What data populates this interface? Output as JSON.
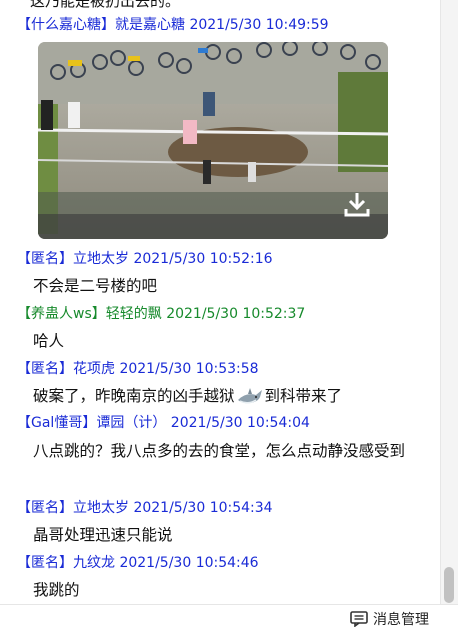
{
  "messages": [
    {
      "group": "什么嘉心糖",
      "sender": "就是嘉心糖",
      "time": "2021/5/30 10:49:59",
      "color": "blue"
    },
    {
      "group": "匿名",
      "sender": "立地太岁",
      "time": "2021/5/30 10:52:16",
      "color": "blue",
      "text": "不会是二号楼的吧"
    },
    {
      "group": "养蛊人ws",
      "sender": "轻轻的飘",
      "time": "2021/5/30 10:52:37",
      "color": "green",
      "text": "哈人"
    },
    {
      "group": "匿名",
      "sender": "花项虎",
      "time": "2021/5/30 10:53:58",
      "color": "blue",
      "text_before": "破案了，昨晚南京的凶手越狱",
      "text_after": "到科带来了"
    },
    {
      "group": "Gal懂哥",
      "sender": "谭园（计）",
      "time": "2021/5/30 10:54:04",
      "color": "blue",
      "text": "八点跳的？我八点多的去的食堂，怎么点动静没感受到"
    },
    {
      "group": "匿名",
      "sender": "立地太岁",
      "time": "2021/5/30 10:54:34",
      "color": "blue",
      "text": "晶哥处理迅速只能说"
    },
    {
      "group": "匿名",
      "sender": "九纹龙",
      "time": "2021/5/30 10:54:46",
      "color": "blue",
      "text": "我跳的"
    }
  ],
  "cut_text": "这乃能是被扔出去的。",
  "toolbar": {
    "manage_label": "消息管理"
  },
  "icons": {
    "download": "download-icon",
    "shark": "shark-emoji-icon",
    "manage": "message-manage-icon"
  }
}
